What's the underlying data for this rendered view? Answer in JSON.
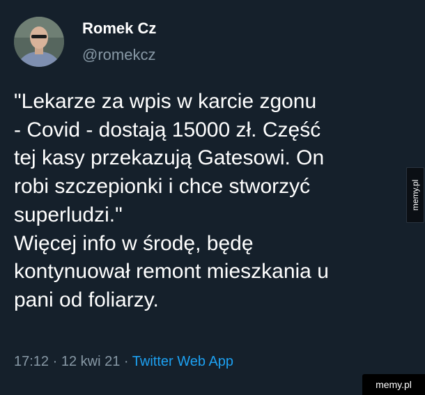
{
  "author": {
    "display_name": "Romek Cz",
    "handle": "@romekcz"
  },
  "tweet": {
    "lines": [
      "\"Lekarze za wpis w karcie zgonu",
      "- Covid - dostają 15000 zł. Część",
      "tej kasy przekazują Gatesowi. On",
      "robi szczepionki i chce stworzyć",
      "superludzi.\"",
      "Więcej info w środę, będę",
      "kontynuował remont mieszkania u",
      "pani od foliarzy."
    ]
  },
  "meta": {
    "time": "17:12",
    "separator": "·",
    "date": "12 kwi 21",
    "source": "Twitter Web App"
  },
  "watermark": {
    "side_text": "memy.pl",
    "corner_text": "memy.pl"
  },
  "colors": {
    "background": "#15202b",
    "text": "#ffffff",
    "secondary": "#8899a6",
    "link": "#1da1f2"
  }
}
